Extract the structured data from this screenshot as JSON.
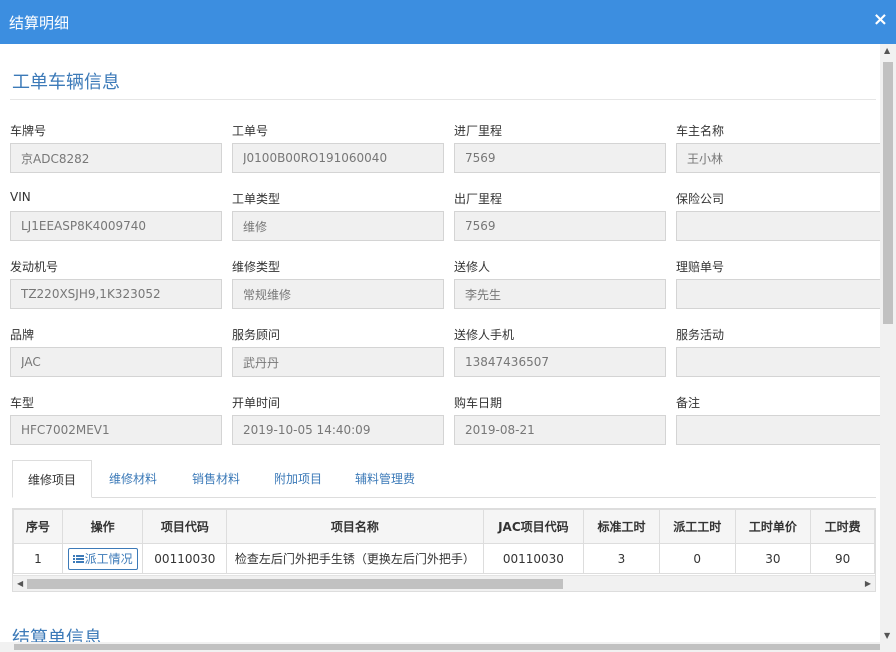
{
  "dialog": {
    "title": "结算明细",
    "close_glyph": "×"
  },
  "section1": {
    "title": "工单车辆信息"
  },
  "fields": [
    {
      "label": "车牌号",
      "value": "京ADC8282"
    },
    {
      "label": "工单号",
      "value": "J0100B00RO191060040"
    },
    {
      "label": "进厂里程",
      "value": "7569"
    },
    {
      "label": "车主名称",
      "value": "王小林"
    },
    {
      "label": "VIN",
      "value": "LJ1EEASP8K4009740"
    },
    {
      "label": "工单类型",
      "value": "维修"
    },
    {
      "label": "出厂里程",
      "value": "7569"
    },
    {
      "label": "保险公司",
      "value": ""
    },
    {
      "label": "发动机号",
      "value": "TZ220XSJH9,1K323052"
    },
    {
      "label": "维修类型",
      "value": "常规维修"
    },
    {
      "label": "送修人",
      "value": "李先生"
    },
    {
      "label": "理赔单号",
      "value": ""
    },
    {
      "label": "品牌",
      "value": "JAC"
    },
    {
      "label": "服务顾问",
      "value": "武丹丹"
    },
    {
      "label": "送修人手机",
      "value": "13847436507"
    },
    {
      "label": "服务活动",
      "value": ""
    },
    {
      "label": "车型",
      "value": "HFC7002MEV1"
    },
    {
      "label": "开单时间",
      "value": "2019-10-05 14:40:09"
    },
    {
      "label": "购车日期",
      "value": "2019-08-21"
    },
    {
      "label": "备注",
      "value": ""
    }
  ],
  "tabs": [
    "维修项目",
    "维修材料",
    "销售材料",
    "附加项目",
    "辅料管理费"
  ],
  "grid": {
    "headers": [
      "序号",
      "操作",
      "项目代码",
      "项目名称",
      "JAC项目代码",
      "标准工时",
      "派工工时",
      "工时单价",
      "工时费"
    ],
    "rows": [
      {
        "no": "1",
        "action": "派工情况",
        "code": "00110030",
        "name": "检查左后门外把手生锈（更换左后门外把手）",
        "jac_code": "00110030",
        "std_hours": "3",
        "dispatch_hours": "0",
        "unit_price": "30",
        "fee": "90"
      }
    ]
  },
  "section2": {
    "title": "结算单信息"
  },
  "icons": {
    "close": "close-icon",
    "list": "list-icon",
    "scroll_left": "arrow-left-icon",
    "scroll_right": "arrow-right-icon",
    "scroll_up": "arrow-up-icon",
    "scroll_down": "arrow-down-icon"
  },
  "colors": {
    "titlebar": "#3c8ee0",
    "accent": "#3c7ab8"
  }
}
